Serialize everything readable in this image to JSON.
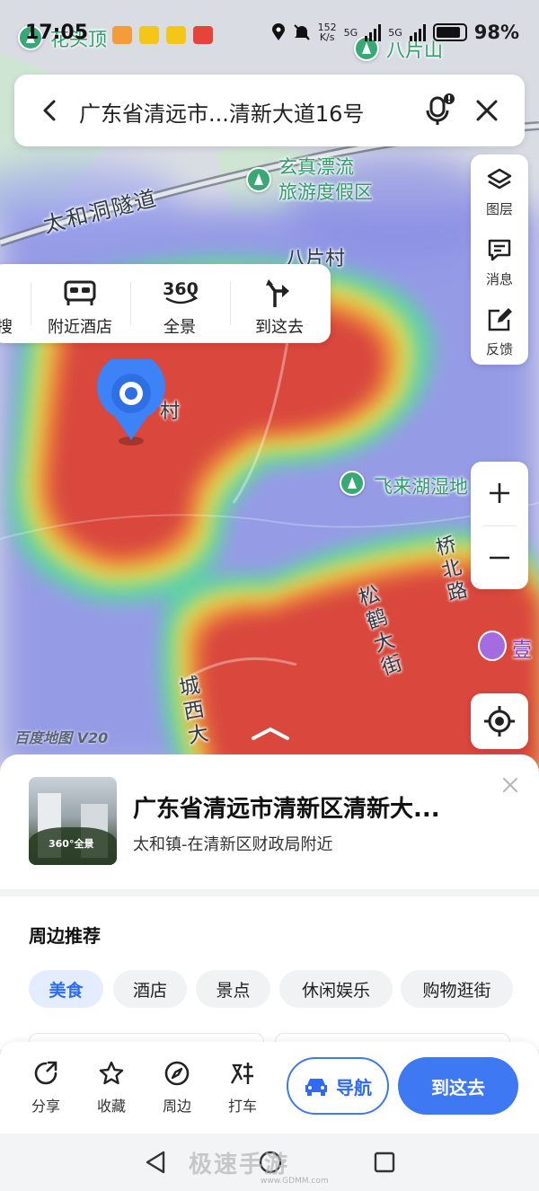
{
  "status_bar": {
    "time": "17:05",
    "net_speed": "152",
    "net_unit": "K/s",
    "signal_1": "5G",
    "signal_2": "5G",
    "battery": "98%"
  },
  "search": {
    "address": "广东省清远市...清新大道16号"
  },
  "map": {
    "labels": {
      "top_left": "花头顶",
      "top_right": "八片山",
      "tunnel": "太和洞隧道",
      "resort": "玄真漂流\n旅游度假区",
      "village": "八片村",
      "pin_suffix": "村",
      "wetland": "飞来湖湿地",
      "songhe": "松鹤大街",
      "qiaobei": "桥北路",
      "chengxi": "城西大",
      "shop": "壹"
    },
    "watermark": "百度地图 V20",
    "heat_colors": {
      "hot": "#d9473e",
      "warm": "#ef9a3a",
      "mild": "#d8e05a",
      "cool": "#5fd0a8",
      "cold": "#7b83e6"
    }
  },
  "right_panel": {
    "layers": "图层",
    "messages": "消息",
    "feedback": "反馈"
  },
  "quick_actions": {
    "search_partial": "搜",
    "hotels": "附近酒店",
    "panorama": "全景",
    "panorama_badge": "360",
    "go_here": "到这去"
  },
  "info_card": {
    "title": "广东省清远市清新区清新大...",
    "subtitle": "太和镇-在清新区财政局附近",
    "thumb_tag": "360°全景"
  },
  "nearby": {
    "heading": "周边推荐",
    "chips": [
      "美食",
      "酒店",
      "景点",
      "休闲娱乐",
      "购物逛街"
    ]
  },
  "action_bar": {
    "share": "分享",
    "favorite": "收藏",
    "around": "周边",
    "taxi": "打车",
    "navigate": "导航",
    "go_here": "到这去"
  },
  "watermark_bottom": {
    "brand": "极速手游",
    "url": "www.GDMM.com"
  },
  "icons": {
    "back": "chevron-left-icon",
    "mic": "microphone-icon",
    "close": "close-icon",
    "layers": "layers-icon",
    "message": "message-icon",
    "feedback": "edit-icon",
    "zoom_in": "plus-icon",
    "zoom_out": "minus-icon",
    "locate": "locate-icon"
  },
  "colors": {
    "accent": "#3e78f3",
    "poi_green": "#3aa876",
    "shop_purple": "#a56be0"
  }
}
